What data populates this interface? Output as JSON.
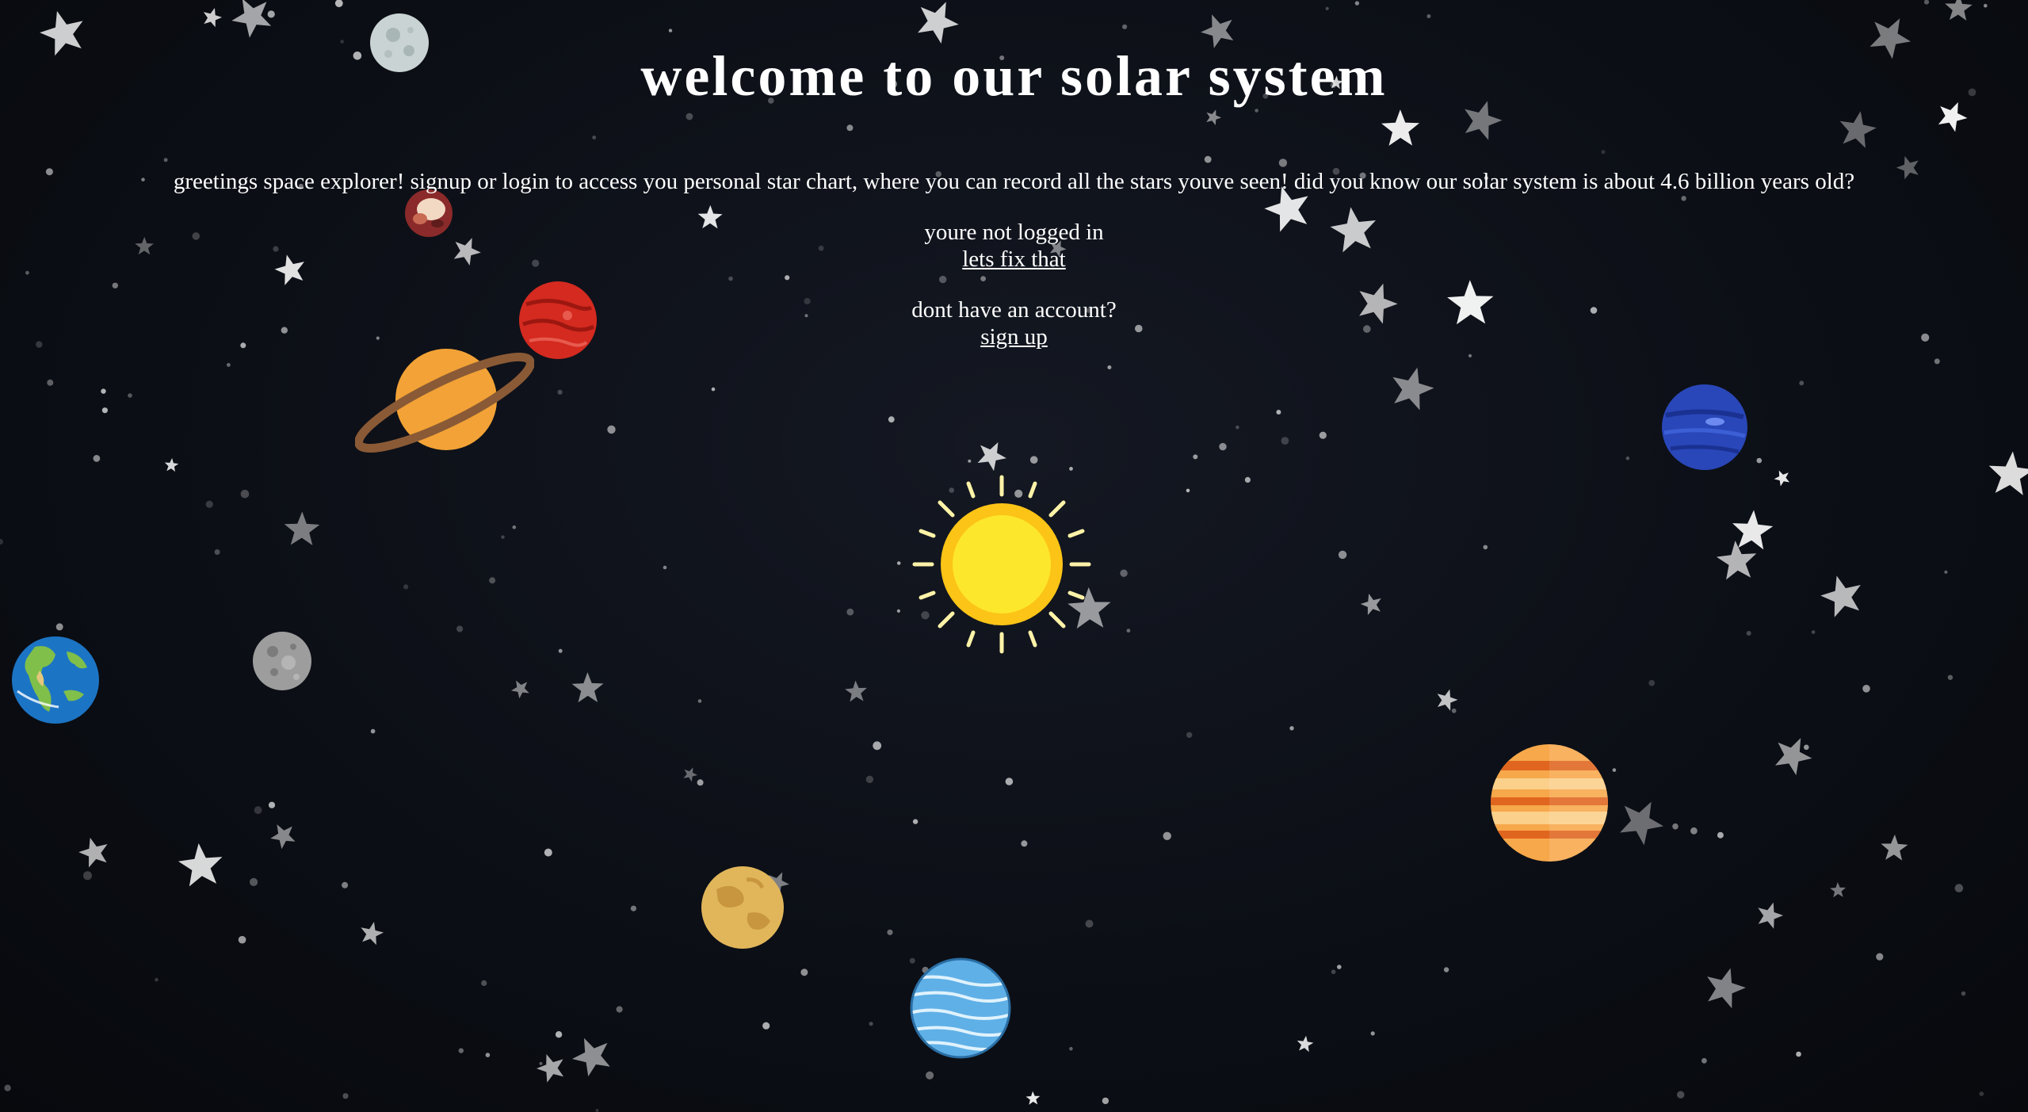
{
  "page": {
    "title": "welcome to our solar system",
    "greeting": "greetings space explorer! signup or login to access you personal star chart, where you can record all the stars youve seen! did you know our solar system is about 4.6 billion years old?",
    "login_status": "youre not logged in",
    "login_link": "lets fix that",
    "no_account": "dont have an account?",
    "signup_link": "sign up"
  },
  "colors": {
    "background": "#0b0e14",
    "text": "#ffffff",
    "sun": "#fde12d",
    "sun_rays": "#fff3a8"
  },
  "icons": [
    "moon-icon",
    "pluto-icon",
    "mars-icon",
    "saturn-icon",
    "neptune-icon",
    "sun-icon",
    "earth-icon",
    "mercury-icon",
    "jupiter-icon",
    "venus-icon",
    "uranus-icon",
    "star-icon"
  ]
}
